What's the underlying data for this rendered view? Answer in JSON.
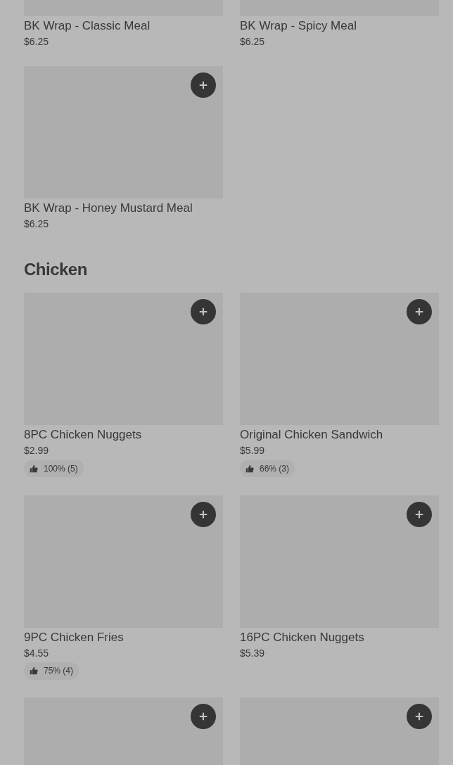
{
  "sections": [
    {
      "items": [
        {
          "name": "BK Wrap - Classic Meal",
          "price": "$6.25"
        },
        {
          "name": "BK Wrap - Spicy Meal",
          "price": "$6.25"
        },
        {
          "name": "BK Wrap - Honey Mustard Meal",
          "price": "$6.25"
        }
      ]
    },
    {
      "title": "Chicken",
      "items": [
        {
          "name": "8PC Chicken Nuggets",
          "price": "$2.99",
          "rating": "100% (5)"
        },
        {
          "name": "Original Chicken Sandwich",
          "price": "$5.99",
          "rating": "66% (3)"
        },
        {
          "name": "9PC Chicken Fries",
          "price": "$4.55",
          "rating": "75% (4)"
        },
        {
          "name": "16PC Chicken Nuggets",
          "price": "$5.39"
        },
        {
          "kind": "picture"
        },
        {
          "kind": "picture"
        }
      ]
    }
  ]
}
